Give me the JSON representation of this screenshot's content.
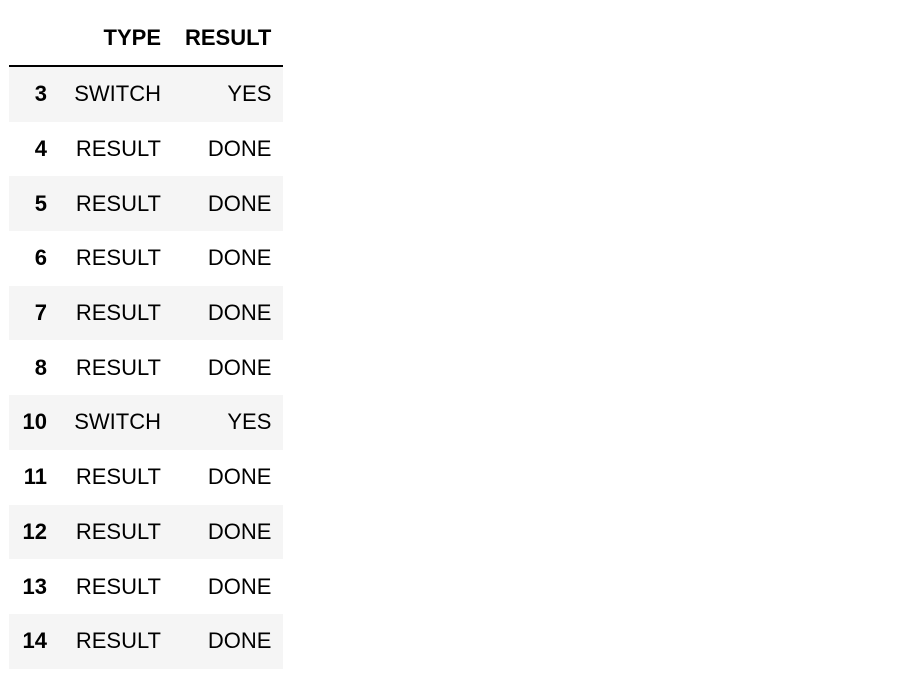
{
  "table": {
    "headers": [
      "",
      "TYPE",
      "RESULT"
    ],
    "rows": [
      {
        "index": "3",
        "type": "SWITCH",
        "result": "YES"
      },
      {
        "index": "4",
        "type": "RESULT",
        "result": "DONE"
      },
      {
        "index": "5",
        "type": "RESULT",
        "result": "DONE"
      },
      {
        "index": "6",
        "type": "RESULT",
        "result": "DONE"
      },
      {
        "index": "7",
        "type": "RESULT",
        "result": "DONE"
      },
      {
        "index": "8",
        "type": "RESULT",
        "result": "DONE"
      },
      {
        "index": "10",
        "type": "SWITCH",
        "result": "YES"
      },
      {
        "index": "11",
        "type": "RESULT",
        "result": "DONE"
      },
      {
        "index": "12",
        "type": "RESULT",
        "result": "DONE"
      },
      {
        "index": "13",
        "type": "RESULT",
        "result": "DONE"
      },
      {
        "index": "14",
        "type": "RESULT",
        "result": "DONE"
      }
    ]
  }
}
